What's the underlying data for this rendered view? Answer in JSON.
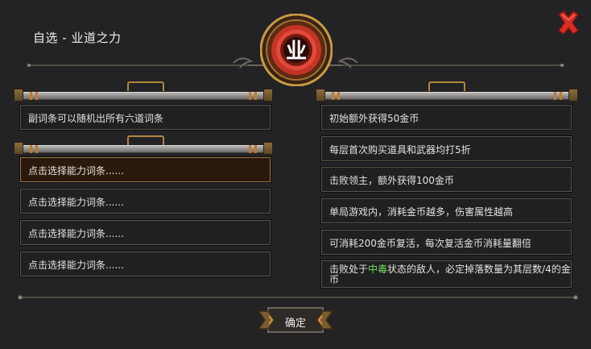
{
  "dialog": {
    "title": "自选 - 业道之力",
    "emblem_glyph": "业",
    "close_icon": "close-x-icon"
  },
  "left": {
    "info": "副词条可以随机出所有六道词条",
    "slots": [
      "点击选择能力词条......",
      "点击选择能力词条......",
      "点击选择能力词条......",
      "点击选择能力词条......"
    ]
  },
  "right": {
    "items": [
      "初始额外获得50金币",
      "每层首次购买道具和武器均打5折",
      "击败领主，额外获得100金币",
      "单局游戏内，消耗金币越多，伤害属性越高",
      "可消耗200金币复活，每次复活金币消耗量翻倍"
    ],
    "last_prefix": "击败处于",
    "last_highlight": "中毒",
    "last_suffix": "状态的敌人，必定掉落数量为其层数/4的金币"
  },
  "confirm_label": "确定",
  "colors": {
    "accent_red": "#d73a2c",
    "highlight_green": "#6ee35c",
    "gold": "#b0873d"
  }
}
